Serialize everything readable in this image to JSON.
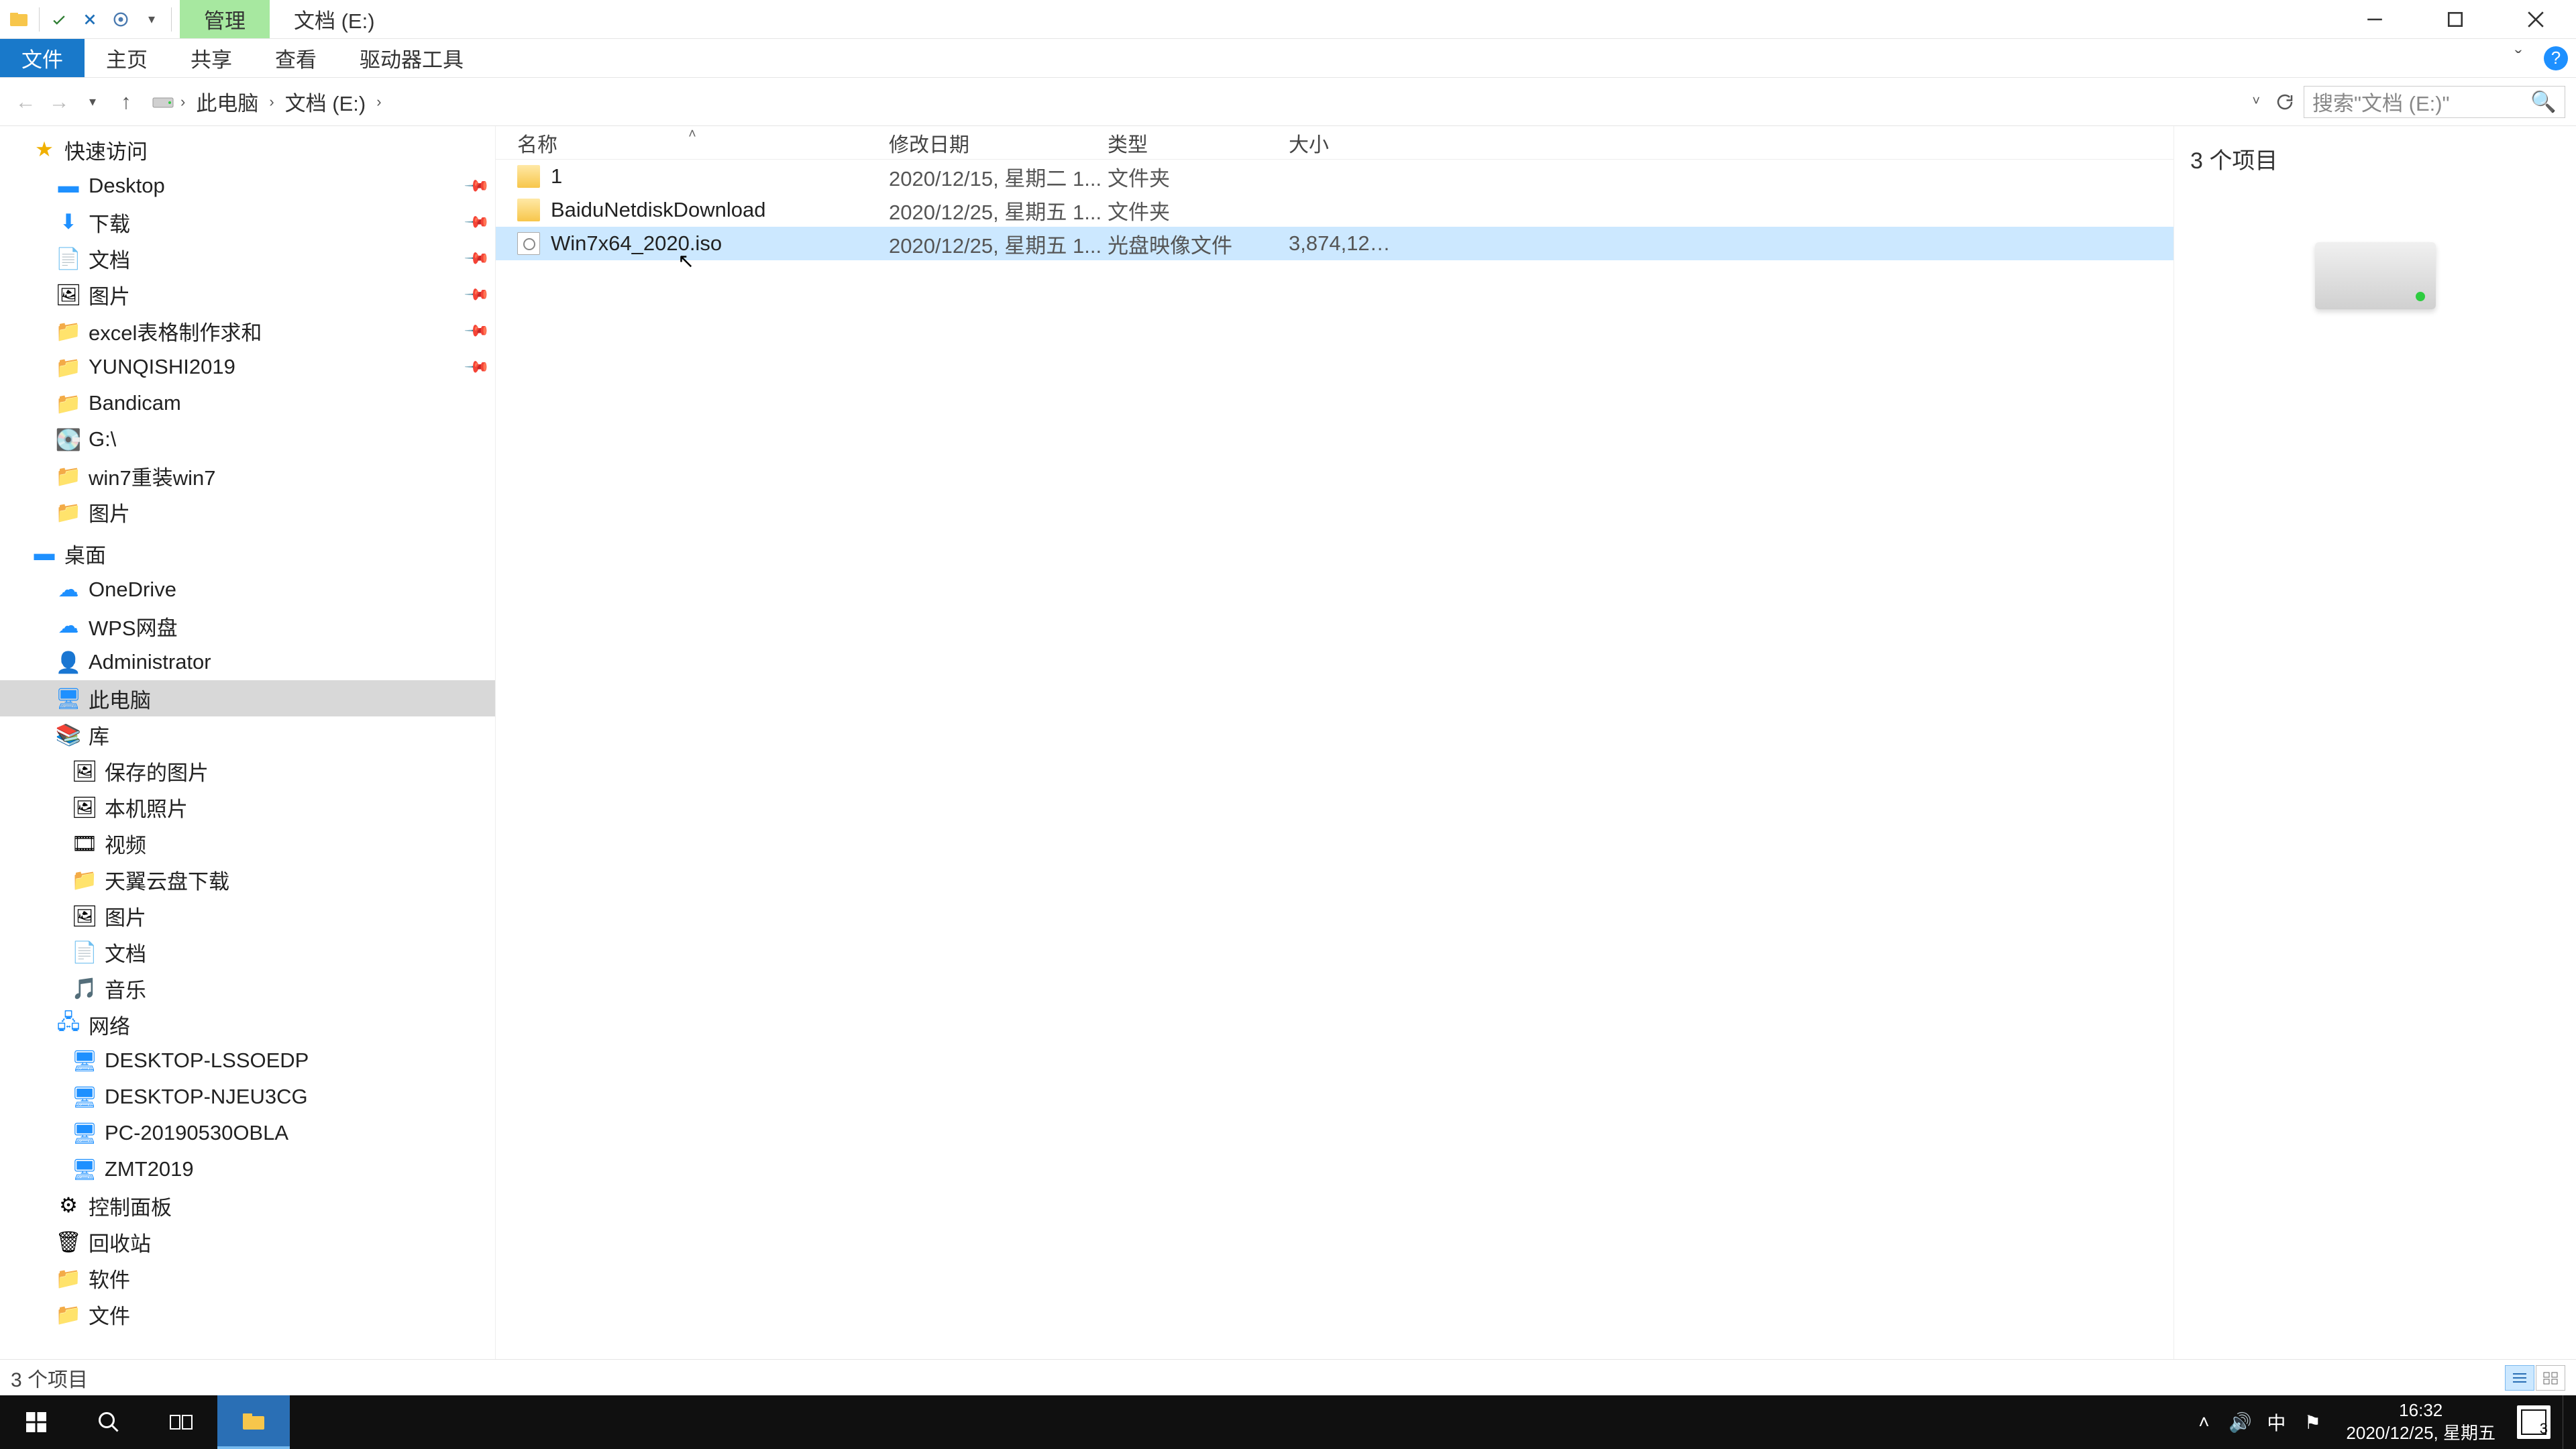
{
  "titlebar": {
    "context_tab": "管理",
    "window_title": "文档 (E:)"
  },
  "ribbon": {
    "file": "文件",
    "home": "主页",
    "share": "共享",
    "view": "查看",
    "drive_tools": "驱动器工具"
  },
  "address": {
    "seg1": "此电脑",
    "seg2": "文档 (E:)",
    "search_placeholder": "搜索\"文档 (E:)\""
  },
  "nav": {
    "quick_access": "快速访问",
    "desktop": "Desktop",
    "downloads": "下载",
    "documents": "文档",
    "pictures": "图片",
    "excel": "excel表格制作求和",
    "yunqishi": "YUNQISHI2019",
    "bandicam": "Bandicam",
    "gdrive": "G:\\",
    "win7rei": "win7重装win7",
    "pictures2": "图片",
    "desktop_root": "桌面",
    "onedrive": "OneDrive",
    "wps": "WPS网盘",
    "admin": "Administrator",
    "thispc": "此电脑",
    "libraries": "库",
    "lib_savedpics": "保存的图片",
    "lib_camera": "本机照片",
    "lib_videos": "视频",
    "lib_tianyi": "天翼云盘下载",
    "lib_pictures": "图片",
    "lib_docs": "文档",
    "lib_music": "音乐",
    "network": "网络",
    "net1": "DESKTOP-LSSOEDP",
    "net2": "DESKTOP-NJEU3CG",
    "net3": "PC-20190530OBLA",
    "net4": "ZMT2019",
    "control_panel": "控制面板",
    "recycle": "回收站",
    "soft": "软件",
    "files": "文件"
  },
  "columns": {
    "name": "名称",
    "date": "修改日期",
    "type": "类型",
    "size": "大小"
  },
  "rows": [
    {
      "name": "1",
      "date": "2020/12/15, 星期二 1...",
      "type": "文件夹",
      "size": "",
      "icon": "folder",
      "selected": false
    },
    {
      "name": "BaiduNetdiskDownload",
      "date": "2020/12/25, 星期五 1...",
      "type": "文件夹",
      "size": "",
      "icon": "folder",
      "selected": false
    },
    {
      "name": "Win7x64_2020.iso",
      "date": "2020/12/25, 星期五 1...",
      "type": "光盘映像文件",
      "size": "3,874,126...",
      "icon": "iso",
      "selected": true
    }
  ],
  "preview": {
    "item_count": "3 个项目"
  },
  "status": {
    "text": "3 个项目"
  },
  "taskbar": {
    "time": "16:32",
    "date": "2020/12/25, 星期五",
    "ime": "中",
    "notif_count": "3"
  }
}
